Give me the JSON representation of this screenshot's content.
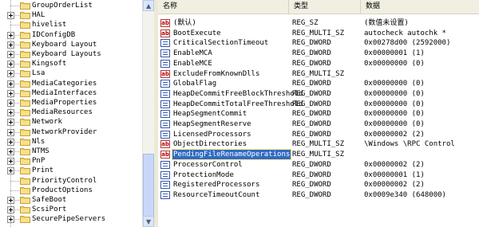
{
  "tree": {
    "items": [
      {
        "label": "GroupOrderList",
        "expandable": false
      },
      {
        "label": "HAL",
        "expandable": true
      },
      {
        "label": "hivelist",
        "expandable": false
      },
      {
        "label": "IDConfigDB",
        "expandable": true
      },
      {
        "label": "Keyboard Layout",
        "expandable": true
      },
      {
        "label": "Keyboard Layouts",
        "expandable": true
      },
      {
        "label": "Kingsoft",
        "expandable": true
      },
      {
        "label": "Lsa",
        "expandable": true
      },
      {
        "label": "MediaCategories",
        "expandable": true
      },
      {
        "label": "MediaInterfaces",
        "expandable": true
      },
      {
        "label": "MediaProperties",
        "expandable": true
      },
      {
        "label": "MediaResources",
        "expandable": true
      },
      {
        "label": "Network",
        "expandable": true
      },
      {
        "label": "NetworkProvider",
        "expandable": true
      },
      {
        "label": "Nls",
        "expandable": true
      },
      {
        "label": "NTMS",
        "expandable": true
      },
      {
        "label": "PnP",
        "expandable": true
      },
      {
        "label": "Print",
        "expandable": true
      },
      {
        "label": "PriorityControl",
        "expandable": false
      },
      {
        "label": "ProductOptions",
        "expandable": false
      },
      {
        "label": "SafeBoot",
        "expandable": true
      },
      {
        "label": "ScsiPort",
        "expandable": true
      },
      {
        "label": "SecurePipeServers",
        "expandable": true
      }
    ]
  },
  "scrollbar": {
    "up_arrow": "▲",
    "down_arrow": "▼"
  },
  "list": {
    "columns": {
      "name": "名称",
      "type": "类型",
      "data": "数据"
    },
    "rows": [
      {
        "icon": "string-value-icon",
        "name": "(默认)",
        "type": "REG_SZ",
        "data": "(数值未设置)"
      },
      {
        "icon": "string-value-icon",
        "name": "BootExecute",
        "type": "REG_MULTI_SZ",
        "data": "autocheck autochk *"
      },
      {
        "icon": "binary-value-icon",
        "name": "CriticalSectionTimeout",
        "type": "REG_DWORD",
        "data": "0x00278d00 (2592000)"
      },
      {
        "icon": "binary-value-icon",
        "name": "EnableMCA",
        "type": "REG_DWORD",
        "data": "0x00000001 (1)"
      },
      {
        "icon": "binary-value-icon",
        "name": "EnableMCE",
        "type": "REG_DWORD",
        "data": "0x00000000 (0)"
      },
      {
        "icon": "string-value-icon",
        "name": "ExcludeFromKnownDlls",
        "type": "REG_MULTI_SZ",
        "data": ""
      },
      {
        "icon": "binary-value-icon",
        "name": "GlobalFlag",
        "type": "REG_DWORD",
        "data": "0x00000000 (0)"
      },
      {
        "icon": "binary-value-icon",
        "name": "HeapDeCommitFreeBlockThreshold",
        "type": "REG_DWORD",
        "data": "0x00000000 (0)"
      },
      {
        "icon": "binary-value-icon",
        "name": "HeapDeCommitTotalFreeThreshold",
        "type": "REG_DWORD",
        "data": "0x00000000 (0)"
      },
      {
        "icon": "binary-value-icon",
        "name": "HeapSegmentCommit",
        "type": "REG_DWORD",
        "data": "0x00000000 (0)"
      },
      {
        "icon": "binary-value-icon",
        "name": "HeapSegmentReserve",
        "type": "REG_DWORD",
        "data": "0x00000000 (0)"
      },
      {
        "icon": "binary-value-icon",
        "name": "LicensedProcessors",
        "type": "REG_DWORD",
        "data": "0x00000002 (2)"
      },
      {
        "icon": "string-value-icon",
        "name": "ObjectDirectories",
        "type": "REG_MULTI_SZ",
        "data": "\\Windows \\RPC Control"
      },
      {
        "icon": "string-value-icon",
        "name": "PendingFileRenameOperations",
        "type": "REG_MULTI_SZ",
        "data": "",
        "selected": true
      },
      {
        "icon": "binary-value-icon",
        "name": "ProcessorControl",
        "type": "REG_DWORD",
        "data": "0x00000002 (2)"
      },
      {
        "icon": "binary-value-icon",
        "name": "ProtectionMode",
        "type": "REG_DWORD",
        "data": "0x00000001 (1)"
      },
      {
        "icon": "binary-value-icon",
        "name": "RegisteredProcessors",
        "type": "REG_DWORD",
        "data": "0x00000002 (2)"
      },
      {
        "icon": "binary-value-icon",
        "name": "ResourceTimeoutCount",
        "type": "REG_DWORD",
        "data": "0x0009e340 (648000)"
      }
    ]
  },
  "colors": {
    "selection": "#316ac5",
    "folder": "#f1cf5a",
    "header_bg": "#f1efe2"
  }
}
